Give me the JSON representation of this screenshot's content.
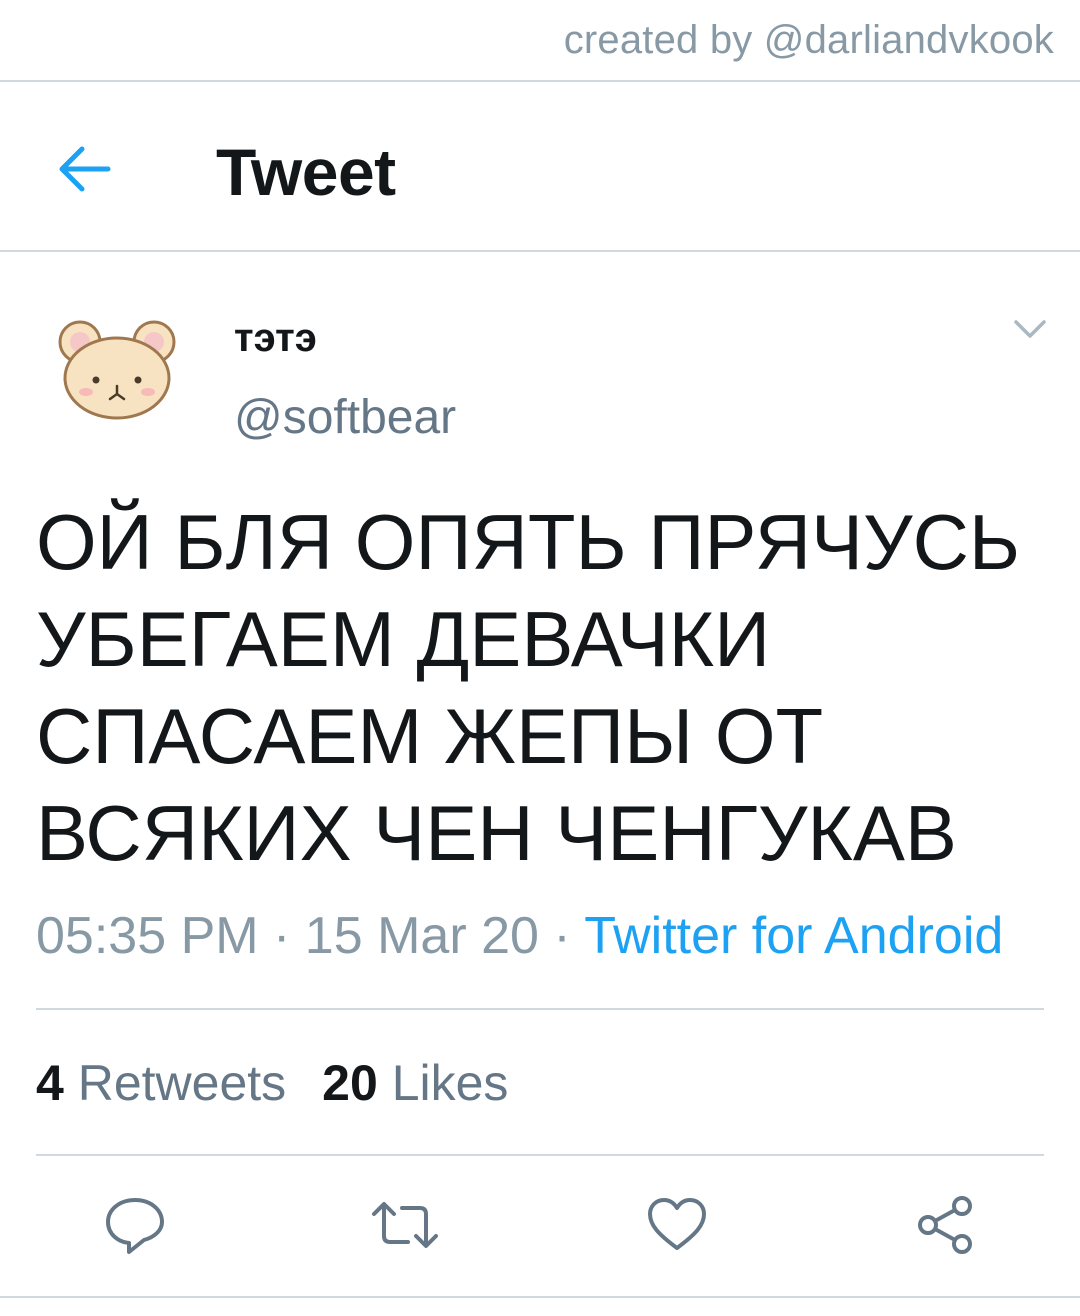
{
  "credit": "created by @darliandvkook",
  "header": {
    "title": "Tweet",
    "back_icon": "arrow-left-icon"
  },
  "tweet": {
    "display_name": "тэтэ",
    "handle": "@softbear",
    "avatar_icon": "bear-avatar",
    "caret_icon": "chevron-down-icon",
    "text": "ОЙ БЛЯ ОПЯТЬ ПРЯЧУСЬ\nУБЕГАЕМ ДЕВАЧКИ\nСПАСАЕМ ЖЕПЫ ОТ\nВСЯКИХ ЧЕН ЧЕНГУКАВ",
    "time": "05:35 PM",
    "separator": " · ",
    "date": "15 Mar 20",
    "source": "Twitter for Android"
  },
  "stats": {
    "retweets_count": "4",
    "retweets_label": "Retweets",
    "likes_count": "20",
    "likes_label": "Likes"
  },
  "actions": [
    "reply-icon",
    "retweet-icon",
    "like-icon",
    "share-icon"
  ],
  "colors": {
    "accent": "#1da1f2",
    "muted": "#657786",
    "text": "#14171a",
    "divider": "#cfd9de"
  }
}
